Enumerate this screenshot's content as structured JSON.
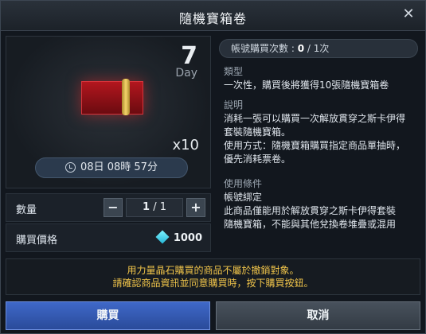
{
  "dialog": {
    "title": "隨機寶箱卷",
    "close_glyph": "✕"
  },
  "item": {
    "duration_value": "7",
    "duration_unit": "Day",
    "quantity_multiplier": "x10",
    "timer": "08日 08時 57分",
    "chest_color": "#b3161e"
  },
  "quantity": {
    "label": "數量",
    "current": "1",
    "separator": "/",
    "max": "1",
    "minus": "−",
    "plus": "+"
  },
  "price": {
    "label": "購買價格",
    "currency_icon": "diamond-icon",
    "value": "1000"
  },
  "purchase_count": {
    "label": "帳號購買次數 : ",
    "current": "0",
    "rest": " / 1次"
  },
  "type_section": {
    "heading": "類型",
    "lines": [
      "一次性，購買後將獲得10張隨機寶箱卷"
    ]
  },
  "desc_section": {
    "heading": "說明",
    "lines": [
      "消耗一張可以購買一次解放貫穿之斯卡伊得",
      "套裝隨機寶箱。",
      "使用方式：隨機寶箱購買指定商品單抽時，",
      "優先消耗票卷。"
    ]
  },
  "cond_section": {
    "heading": "使用條件",
    "lines": [
      "帳號綁定",
      "此商品僅能用於解放貫穿之斯卡伊得套裝",
      "隨機寶箱，不能與其他兌換卷堆疊或混用"
    ]
  },
  "notice": {
    "line1": "用力量晶石購買的商品不屬於撤銷對象。",
    "line2": "請確認商品資訊並同意購買時，按下購買按鈕。"
  },
  "buttons": {
    "buy": "購買",
    "cancel": "取消"
  },
  "colors": {
    "accent_gold": "#f0c44a",
    "buy_blue": "#3f68c8"
  }
}
